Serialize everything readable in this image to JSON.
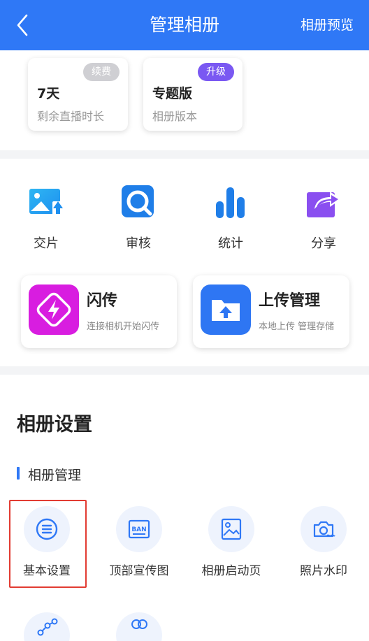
{
  "header": {
    "title": "管理相册",
    "right_action": "相册预览"
  },
  "stats": [
    {
      "badge": "续费",
      "value": "7天",
      "desc": "剩余直播时长"
    },
    {
      "badge": "升级",
      "value": "专题版",
      "desc": "相册版本"
    }
  ],
  "tools": [
    {
      "label": "交片",
      "icon": "image-upload-icon"
    },
    {
      "label": "审核",
      "icon": "review-search-icon"
    },
    {
      "label": "统计",
      "icon": "bar-chart-icon"
    },
    {
      "label": "分享",
      "icon": "share-icon"
    }
  ],
  "features": [
    {
      "title": "闪传",
      "desc": "连接相机开始闪传",
      "icon": "lightning-icon"
    },
    {
      "title": "上传管理",
      "desc": "本地上传 管理存储",
      "icon": "folder-upload-icon"
    }
  ],
  "settings": {
    "title": "相册设置",
    "subtitle": "相册管理",
    "items": [
      {
        "label": "基本设置",
        "icon": "list-icon"
      },
      {
        "label": "顶部宣传图",
        "icon": "banner-icon"
      },
      {
        "label": "相册启动页",
        "icon": "image-frame-icon"
      },
      {
        "label": "照片水印",
        "icon": "camera-icon"
      }
    ]
  },
  "colors": {
    "primary": "#2f78f6",
    "flash": "#d81de0",
    "upgrade": "#7a58f2"
  }
}
